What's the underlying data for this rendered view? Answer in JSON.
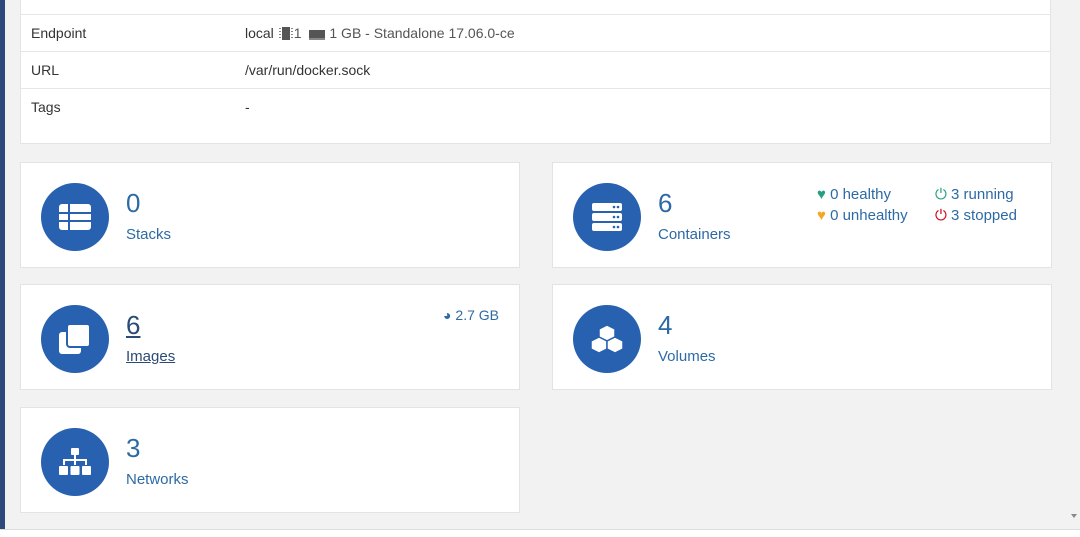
{
  "endpoint_info": {
    "rows": [
      {
        "key": "Endpoint",
        "value_name": "local",
        "cpu": "1",
        "memory": "1 GB",
        "mode": "- Standalone 17.06.0-ce"
      },
      {
        "key": "URL",
        "value": "/var/run/docker.sock"
      },
      {
        "key": "Tags",
        "value": "-"
      }
    ]
  },
  "cards": {
    "stacks": {
      "count": "0",
      "label": "Stacks"
    },
    "containers": {
      "count": "6",
      "label": "Containers",
      "healthy": "0 healthy",
      "unhealthy": "0 unhealthy",
      "running": "3 running",
      "stopped": "3 stopped"
    },
    "images": {
      "count": "6",
      "label": "Images",
      "size": "2.7 GB"
    },
    "volumes": {
      "count": "4",
      "label": "Volumes"
    },
    "networks": {
      "count": "3",
      "label": "Networks"
    }
  },
  "colors": {
    "accent": "#2761b0",
    "text_link": "#2d6aa5",
    "healthy": "#25a07e",
    "unhealthy": "#f5a623",
    "stopped": "#d0021b"
  }
}
